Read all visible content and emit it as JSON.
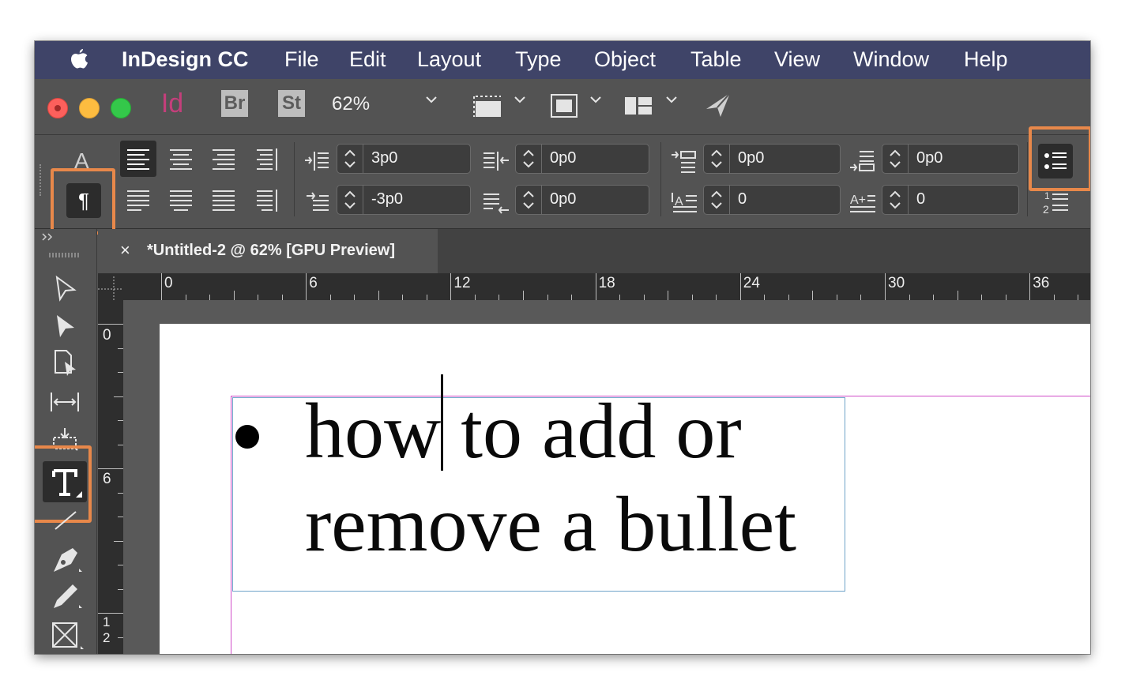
{
  "menubar": {
    "app_name": "InDesign CC",
    "items": [
      "File",
      "Edit",
      "Layout",
      "Type",
      "Object",
      "Table",
      "View",
      "Window",
      "Help"
    ]
  },
  "appbar": {
    "apps": [
      {
        "label": "Id",
        "color": "#9b3a63"
      },
      {
        "label": "Br",
        "color": "#5c5c5c"
      },
      {
        "label": "St",
        "color": "#5c5c5c"
      }
    ],
    "zoom": "62%"
  },
  "control_panel": {
    "character_mode_label": "A",
    "paragraph_mode_label": "¶",
    "fields": {
      "left_indent": "3p0",
      "first_line_indent": "-3p0",
      "right_indent": "0p0",
      "last_line_right_indent": "0p0",
      "space_before": "0p0",
      "space_after": "0p0",
      "drop_cap_lines": "0",
      "drop_cap_chars": "0"
    }
  },
  "document": {
    "tab_close": "×",
    "tab_title": "*Untitled-2 @ 62% [GPU Preview]",
    "text_lines": [
      "how to add or",
      "remove a bullet"
    ]
  },
  "rulers": {
    "horizontal_labels": [
      "0",
      "6",
      "12",
      "18",
      "24",
      "30",
      "36"
    ],
    "vertical_labels": [
      "0",
      "6",
      "1",
      "2"
    ]
  },
  "colors": {
    "menubar": "#3f4468",
    "panel": "#535353",
    "highlight": "#e8884a",
    "margin_guide": "#d04cc8",
    "frame_edge": "#6fa3c9"
  }
}
